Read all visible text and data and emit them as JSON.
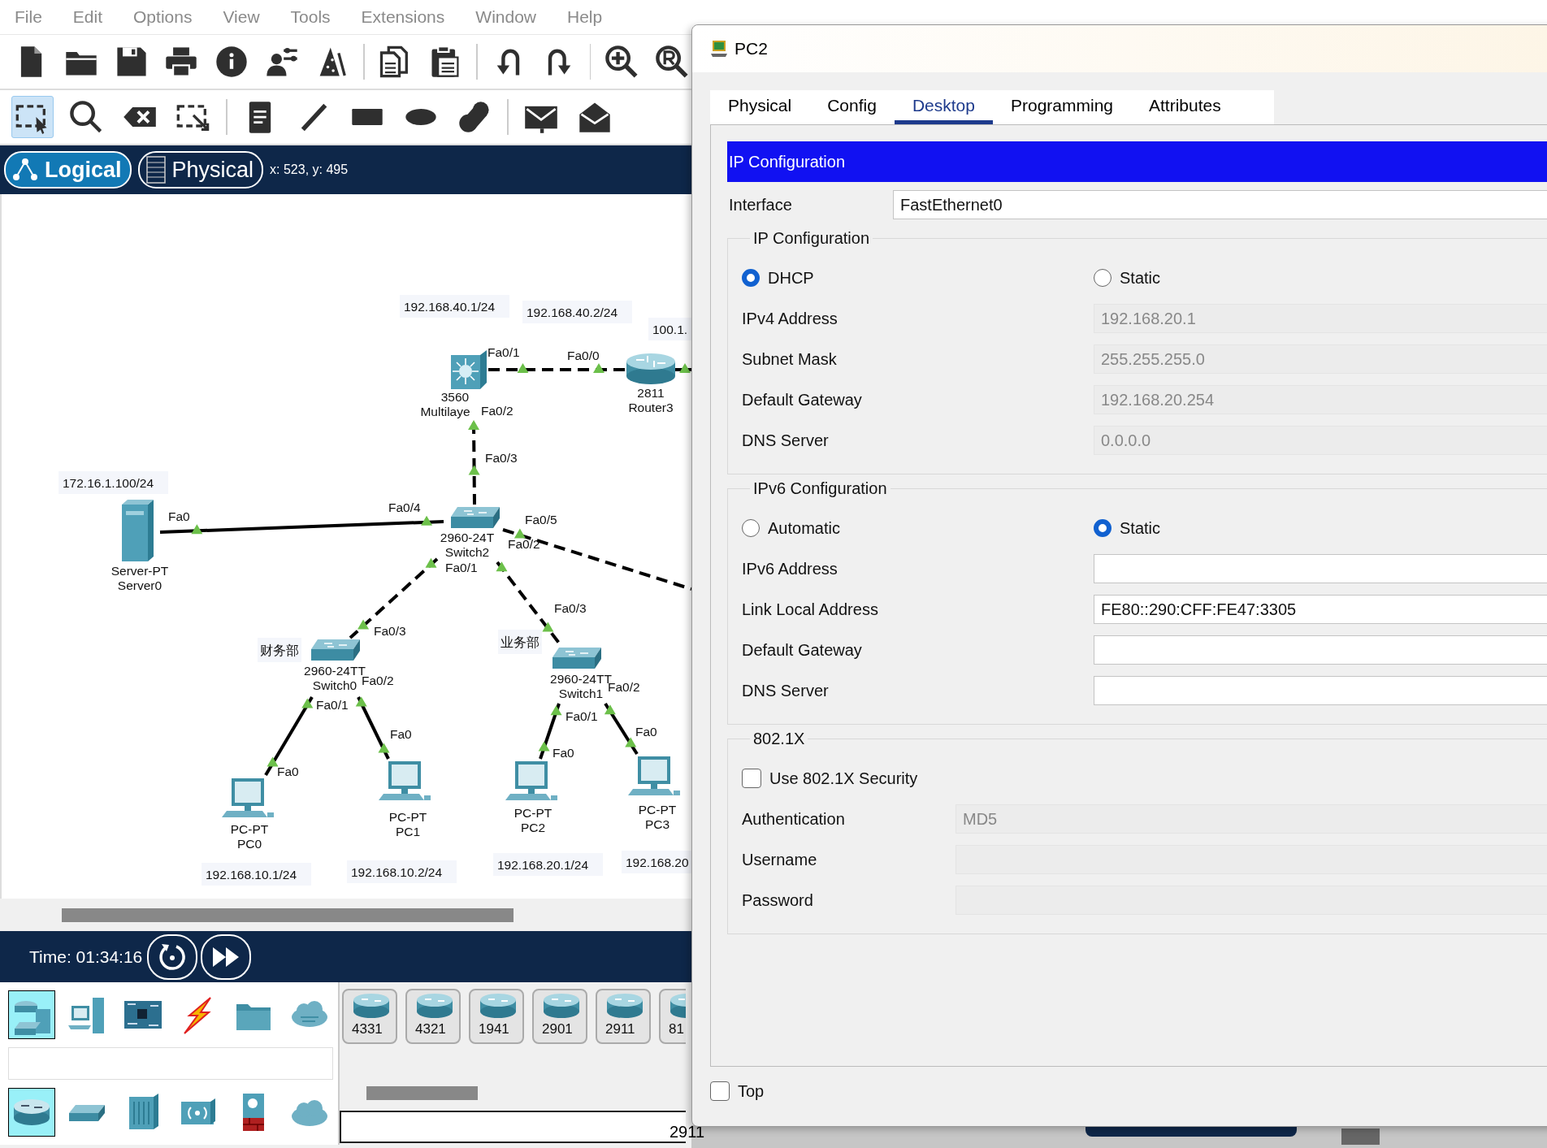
{
  "menu": [
    "File",
    "Edit",
    "Options",
    "View",
    "Tools",
    "Extensions",
    "Window",
    "Help"
  ],
  "edit_tools": [
    {
      "selected": true
    },
    {
      "selected": false
    },
    {
      "selected": false
    },
    {
      "selected": false
    },
    {
      "selected": false
    },
    {
      "selected": false
    },
    {
      "selected": false
    },
    {
      "selected": false
    },
    {
      "selected": false
    },
    {
      "selected": false
    },
    {
      "selected": false
    }
  ],
  "workspace_tabs": [
    {
      "label": "Logical",
      "selected": true
    },
    {
      "label": "Physical",
      "selected": false
    }
  ],
  "cursor_position": "x: 523, y: 495",
  "topology": {
    "links": [
      {
        "kind": "dashed"
      },
      {
        "kind": "solid"
      },
      {
        "kind": "dashed"
      },
      {
        "kind": "solid"
      },
      {
        "kind": "dashed"
      },
      {
        "kind": "dashed"
      },
      {
        "kind": "dashed"
      },
      {
        "kind": "solid"
      },
      {
        "kind": "solid"
      },
      {
        "kind": "solid"
      },
      {
        "kind": "solid"
      }
    ],
    "devices": [
      {
        "kind": "multilayer",
        "lines": [
          "3560",
          "Multilaye"
        ]
      },
      {
        "kind": "router",
        "lines": [
          "2811",
          "Router3"
        ]
      },
      {
        "kind": "switch",
        "lines": [
          "2960-24T",
          "Switch2"
        ]
      },
      {
        "kind": "server",
        "lines": [
          "Server-PT",
          "Server0"
        ]
      },
      {
        "kind": "switch",
        "lines": [
          "2960-24TT",
          "Switch0"
        ]
      },
      {
        "kind": "switch",
        "lines": [
          "2960-24TT",
          "Switch1"
        ]
      },
      {
        "kind": "pc",
        "lines": [
          "PC-PT",
          "PC0"
        ]
      },
      {
        "kind": "pc",
        "lines": [
          "PC-PT",
          "PC1"
        ]
      },
      {
        "kind": "pc",
        "lines": [
          "PC-PT",
          "PC2"
        ]
      },
      {
        "kind": "pc",
        "lines": [
          "PC-PT",
          "PC3"
        ]
      }
    ],
    "ip_labels": [
      "192.168.40.1/24",
      "192.168.40.2/24",
      "100.1.",
      "172.16.1.100/24",
      "192.168.10.1/24",
      "192.168.10.2/24",
      "192.168.20.1/24",
      "192.168.20"
    ],
    "area_labels": [
      "财务部",
      "业务部"
    ],
    "port_labels": [
      "Fa0/1",
      "Fa0/0",
      "Fa0/2",
      "Fa0/3",
      "Fa0",
      "Fa0/4",
      "Fa0/5",
      "Fa0/2",
      "Fa0/1",
      "Fa0/3",
      "Fa0/3",
      "Fa0/2",
      "Fa0/1",
      "Fa0",
      "Fa0",
      "Fa0/2",
      "Fa0/1",
      "Fa0",
      "Fa0"
    ]
  },
  "simulation": {
    "time": "Time: 01:34:16"
  },
  "device_categories": [
    {
      "selected": true
    },
    {
      "selected": false
    },
    {
      "selected": false
    },
    {
      "selected": false
    },
    {
      "selected": false
    },
    {
      "selected": false
    }
  ],
  "device_subcategories": [
    {
      "selected": true
    },
    {
      "selected": false
    },
    {
      "selected": false
    },
    {
      "selected": false
    },
    {
      "selected": false
    },
    {
      "selected": false
    }
  ],
  "device_models": [
    "4331",
    "4321",
    "1941",
    "2901",
    "2911",
    "81"
  ],
  "model_field": "2911",
  "dialog": {
    "title": "PC2",
    "tabs": [
      {
        "label": "Physical",
        "selected": false
      },
      {
        "label": "Config",
        "selected": false
      },
      {
        "label": "Desktop",
        "selected": true
      },
      {
        "label": "Programming",
        "selected": false
      },
      {
        "label": "Attributes",
        "selected": false
      }
    ],
    "header": "IP Configuration",
    "interface": {
      "label": "Interface",
      "value": "FastEthernet0"
    },
    "ipv4": {
      "legend": "IP Configuration",
      "modes": [
        {
          "label": "DHCP",
          "selected": true
        },
        {
          "label": "Static",
          "selected": false
        }
      ],
      "fields": [
        {
          "label": "IPv4 Address",
          "value": "192.168.20.1",
          "disabled": true
        },
        {
          "label": "Subnet Mask",
          "value": "255.255.255.0",
          "disabled": true
        },
        {
          "label": "Default Gateway",
          "value": "192.168.20.254",
          "disabled": true
        },
        {
          "label": "DNS Server",
          "value": "0.0.0.0",
          "disabled": true
        }
      ]
    },
    "ipv6": {
      "legend": "IPv6 Configuration",
      "modes": [
        {
          "label": "Automatic",
          "selected": false
        },
        {
          "label": "Static",
          "selected": true
        }
      ],
      "fields": [
        {
          "label": "IPv6 Address",
          "disabled": false
        },
        {
          "label": "Link Local Address",
          "value": "FE80::290:CFF:FE47:3305",
          "disabled": false
        },
        {
          "label": "Default Gateway",
          "disabled": false
        },
        {
          "label": "DNS Server",
          "disabled": false
        }
      ]
    },
    "dot1x": {
      "legend": "802.1X",
      "use_security": {
        "label": "Use 802.1X Security",
        "checked": false
      },
      "fields": [
        {
          "label": "Authentication",
          "value": "MD5",
          "disabled": true
        },
        {
          "label": "Username",
          "disabled": true
        },
        {
          "label": "Password",
          "disabled": true
        }
      ]
    },
    "top": {
      "label": "Top",
      "checked": false
    }
  }
}
